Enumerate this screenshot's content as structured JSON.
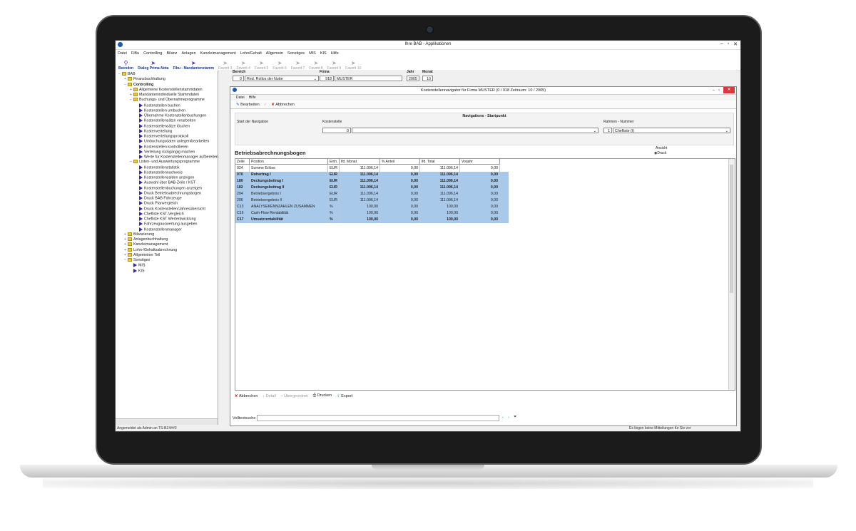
{
  "window": {
    "title": "Ihre BAB - Applikationen",
    "controls": [
      "–",
      "▫",
      "✕"
    ]
  },
  "menubar": [
    "Datei",
    "FiBu",
    "Controlling",
    "Bilanz",
    "Anlagen",
    "Kanzleimanagement",
    "Lohn/Gehalt",
    "Allgemein",
    "Sonstiges",
    "MIS",
    "KIS",
    "Hilfe"
  ],
  "toolbar": [
    {
      "label": "Beenden",
      "enabled": true
    },
    {
      "label": "Dialog Prima-Nota",
      "enabled": true
    },
    {
      "label": "Fibu - Mandantenstamm",
      "enabled": true
    },
    {
      "label": "Favorit 3",
      "enabled": false
    },
    {
      "label": "Favorit 4",
      "enabled": false
    },
    {
      "label": "Favorit 5",
      "enabled": false
    },
    {
      "label": "Favorit 6",
      "enabled": false
    },
    {
      "label": "Favorit 7",
      "enabled": false
    },
    {
      "label": "Favorit 8",
      "enabled": false
    },
    {
      "label": "Favorit 9",
      "enabled": false
    },
    {
      "label": "Favorit 10",
      "enabled": false
    }
  ],
  "tree": [
    {
      "level": 0,
      "icon": "folder",
      "label": "BAB",
      "pm": "−"
    },
    {
      "level": 1,
      "icon": "folder",
      "label": "Finanzbuchhaltung",
      "pm": "+"
    },
    {
      "level": 1,
      "icon": "folder",
      "label": "Controlling",
      "pm": "−",
      "bold": true
    },
    {
      "level": 2,
      "icon": "folder",
      "label": "Allgemeine Kostenstellenstammdaten",
      "pm": "+"
    },
    {
      "level": 2,
      "icon": "folder",
      "label": "Mandantenindividuelle Stammdaten",
      "pm": "+"
    },
    {
      "level": 2,
      "icon": "folder",
      "label": "Buchungs- und Übernahmeprogramme",
      "pm": "−"
    },
    {
      "level": 3,
      "icon": "arrow",
      "label": "Kostenstellen buchen"
    },
    {
      "level": 3,
      "icon": "arrow",
      "label": "Kostenstellen umbuchen"
    },
    {
      "level": 3,
      "icon": "arrow",
      "label": "Übernahme Kostenstellenbuchungen"
    },
    {
      "level": 3,
      "icon": "arrow",
      "label": "Kostenstellensätze verarbeiten"
    },
    {
      "level": 3,
      "icon": "arrow",
      "label": "Kostenstellensätze löschen"
    },
    {
      "level": 3,
      "icon": "arrow",
      "label": "Kostenverteilung"
    },
    {
      "level": 3,
      "icon": "arrow",
      "label": "Kostenverteilungsprotokoll"
    },
    {
      "level": 3,
      "icon": "arrow",
      "label": "Umbuchungsdaten anlegen/bearbeiten"
    },
    {
      "level": 3,
      "icon": "arrow",
      "label": "Kostenstellen kontrollieren"
    },
    {
      "level": 3,
      "icon": "arrow",
      "label": "Verteilung rückgängig machen"
    },
    {
      "level": 3,
      "icon": "arrow",
      "label": "Werte für Kostenstellenmanager aufbereiten"
    },
    {
      "level": 2,
      "icon": "folder",
      "label": "Listen- und Auswertungsprogramme",
      "pm": "−"
    },
    {
      "level": 3,
      "icon": "arrow",
      "label": "Kostenstellenstatistik"
    },
    {
      "level": 3,
      "icon": "arrow",
      "label": "Kostenstellennachweis"
    },
    {
      "level": 3,
      "icon": "arrow",
      "label": "Kostenstellensalden anzeigen"
    },
    {
      "level": 3,
      "icon": "arrow",
      "label": "Auswahl über BAB-Zeile / KST"
    },
    {
      "level": 3,
      "icon": "arrow",
      "label": "Kostenstellenbuchungen anzeigen"
    },
    {
      "level": 3,
      "icon": "arrow",
      "label": "Druck Betriebsabrechnungsbogen"
    },
    {
      "level": 3,
      "icon": "arrow",
      "label": "Druck BAB Fahrzeuge"
    },
    {
      "level": 3,
      "icon": "arrow",
      "label": "Druck Planvergleich"
    },
    {
      "level": 3,
      "icon": "arrow",
      "label": "Druck Kostenstellen/Jahresübersicht"
    },
    {
      "level": 3,
      "icon": "arrow",
      "label": "Chefliste KST-Vergleich"
    },
    {
      "level": 3,
      "icon": "arrow",
      "label": "Chefliste KST Wertentwicklung"
    },
    {
      "level": 3,
      "icon": "arrow",
      "label": "Fahrzeugauswertung ausgeben"
    },
    {
      "level": 3,
      "icon": "arrow",
      "label": "Kostenstellenmanager"
    },
    {
      "level": 1,
      "icon": "folder",
      "label": "Bilanzierung",
      "pm": "+"
    },
    {
      "level": 1,
      "icon": "folder",
      "label": "Anlagenbuchhaltung",
      "pm": "+"
    },
    {
      "level": 1,
      "icon": "folder",
      "label": "Kanzleimanagement",
      "pm": "+"
    },
    {
      "level": 1,
      "icon": "folder",
      "label": "Lohn-/Gehaltsabrechnung",
      "pm": "+"
    },
    {
      "level": 1,
      "icon": "folder",
      "label": "Allgemeiner Teil",
      "pm": "+"
    },
    {
      "level": 1,
      "icon": "folder",
      "label": "Sonstiges",
      "pm": "−"
    },
    {
      "level": 2,
      "icon": "arrow",
      "label": "MIS"
    },
    {
      "level": 2,
      "icon": "arrow",
      "label": "KIS"
    }
  ],
  "filter": {
    "bereich_label": "Bereich",
    "bereich_num": "0",
    "bereich_value": "Red. Rollos der Nutte",
    "firma_label": "Firma",
    "firma_num": "918",
    "firma_value": "MUSTER",
    "jahr_label": "Jahr",
    "jahr_value": "2005",
    "monat_label": "Monat",
    "monat_value": "10"
  },
  "navigator": {
    "title": "Kostenstellennavigator für Firma MUSTER (0 / 918 Zeitraum: 10 / 2005)",
    "menu": [
      "Datei",
      "Hilfe"
    ],
    "tools": {
      "edit": "Bearbeiten",
      "cancel": "Abbrechen"
    },
    "nav_header": "Navigations - Startpunkt",
    "start_label": "Start der Navigation",
    "kst_label": "Kostenstelle",
    "kst_num": "0",
    "rahmen_label": "Rahmen - Nummer",
    "rahmen_num": "1",
    "rahmen_value": "Chefliste (I)",
    "section_title": "Betriebsabrechnungsbogen",
    "ansicht_label": "Ansicht",
    "ansicht_option": "Druck"
  },
  "grid": {
    "columns": [
      "Zeile",
      "Position",
      "Einh.",
      "lfd. Monat",
      "% Anteil",
      "lfd. Total",
      "Vorjahr"
    ],
    "rows": [
      {
        "zeile": "024",
        "position": "Summe Erlöse",
        "einh": "EUR",
        "monat": "111.096,14",
        "anteil": "0,00",
        "total": "111.096,14",
        "vorjahr": "0,00",
        "sel": false,
        "bold": false
      },
      {
        "zeile": "070",
        "position": "Rohertrag I",
        "einh": "EUR",
        "monat": "111.096,14",
        "anteil": "0,00",
        "total": "111.096,14",
        "vorjahr": "0,00",
        "sel": true,
        "bold": true
      },
      {
        "zeile": "180",
        "position": "Deckungsbeitrag I",
        "einh": "EUR",
        "monat": "111.096,14",
        "anteil": "0,00",
        "total": "111.096,14",
        "vorjahr": "0,00",
        "sel": true,
        "bold": true
      },
      {
        "zeile": "182",
        "position": "Deckungsbeitrag II",
        "einh": "EUR",
        "monat": "111.096,14",
        "anteil": "0,00",
        "total": "111.096,14",
        "vorjahr": "0,00",
        "sel": true,
        "bold": true
      },
      {
        "zeile": "204",
        "position": "Betriebsergebnis I",
        "einh": "EUR",
        "monat": "111.096,14",
        "anteil": "0,00",
        "total": "111.096,14",
        "vorjahr": "0,00",
        "sel": true,
        "bold": false
      },
      {
        "zeile": "206",
        "position": "Betriebsergebnis II",
        "einh": "EUR",
        "monat": "111.096,14",
        "anteil": "0,00",
        "total": "111.096,14",
        "vorjahr": "0,00",
        "sel": true,
        "bold": false
      },
      {
        "zeile": "C13",
        "position": "ANALYSEKENNZAHLEN ZUSAMMEN",
        "einh": "%",
        "monat": "100,00",
        "anteil": "0,00",
        "total": "100,00",
        "vorjahr": "0,00",
        "sel": true,
        "bold": false
      },
      {
        "zeile": "C16",
        "position": "Cash-Flow Rentabilität",
        "einh": "%",
        "monat": "100,00",
        "anteil": "0,00",
        "total": "100,00",
        "vorjahr": "0,00",
        "sel": true,
        "bold": false
      },
      {
        "zeile": "C17",
        "position": "Umsatzrentabilität",
        "einh": "%",
        "monat": "100,00",
        "anteil": "0,00",
        "total": "100,00",
        "vorjahr": "0,00",
        "sel": true,
        "bold": true
      }
    ]
  },
  "bottom_tools": {
    "cancel": "Abbrechen",
    "detail": "Detail",
    "overview": "Übergeordnet",
    "print": "Drucken",
    "export": "Export"
  },
  "search": {
    "label": "Volltextsuche"
  },
  "status": {
    "left": "Angemeldet als Admin an TS-BZ4##0",
    "right": "Es liegen keine Mitteilungen für Sie vor"
  },
  "colors": {
    "selection": "#a9c9ea",
    "accent": "#1e58b5",
    "close": "#d83a3a"
  }
}
